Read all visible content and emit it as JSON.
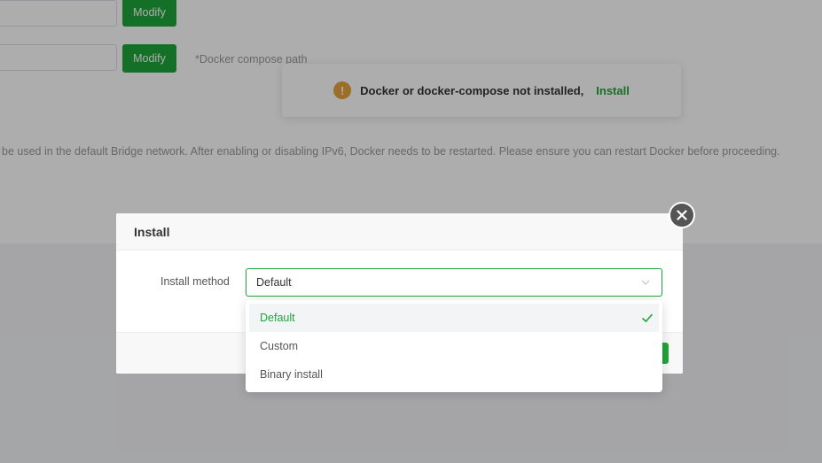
{
  "background": {
    "modify_label": "Modify",
    "compose_hint": "*Docker compose path",
    "ipv6_description": "be used in the default Bridge network. After enabling or disabling IPv6, Docker needs to be restarted. Please ensure you can restart Docker before proceeding."
  },
  "notice": {
    "icon": "warning-icon",
    "message": "Docker or docker-compose not installed,",
    "link": "Install"
  },
  "dialog": {
    "title": "Install",
    "install_method_label": "Install method",
    "selected_value": "Default",
    "options": [
      "Default",
      "Custom",
      "Binary install"
    ]
  },
  "colors": {
    "accent": "#20a53a",
    "warning": "#e6a23c"
  }
}
